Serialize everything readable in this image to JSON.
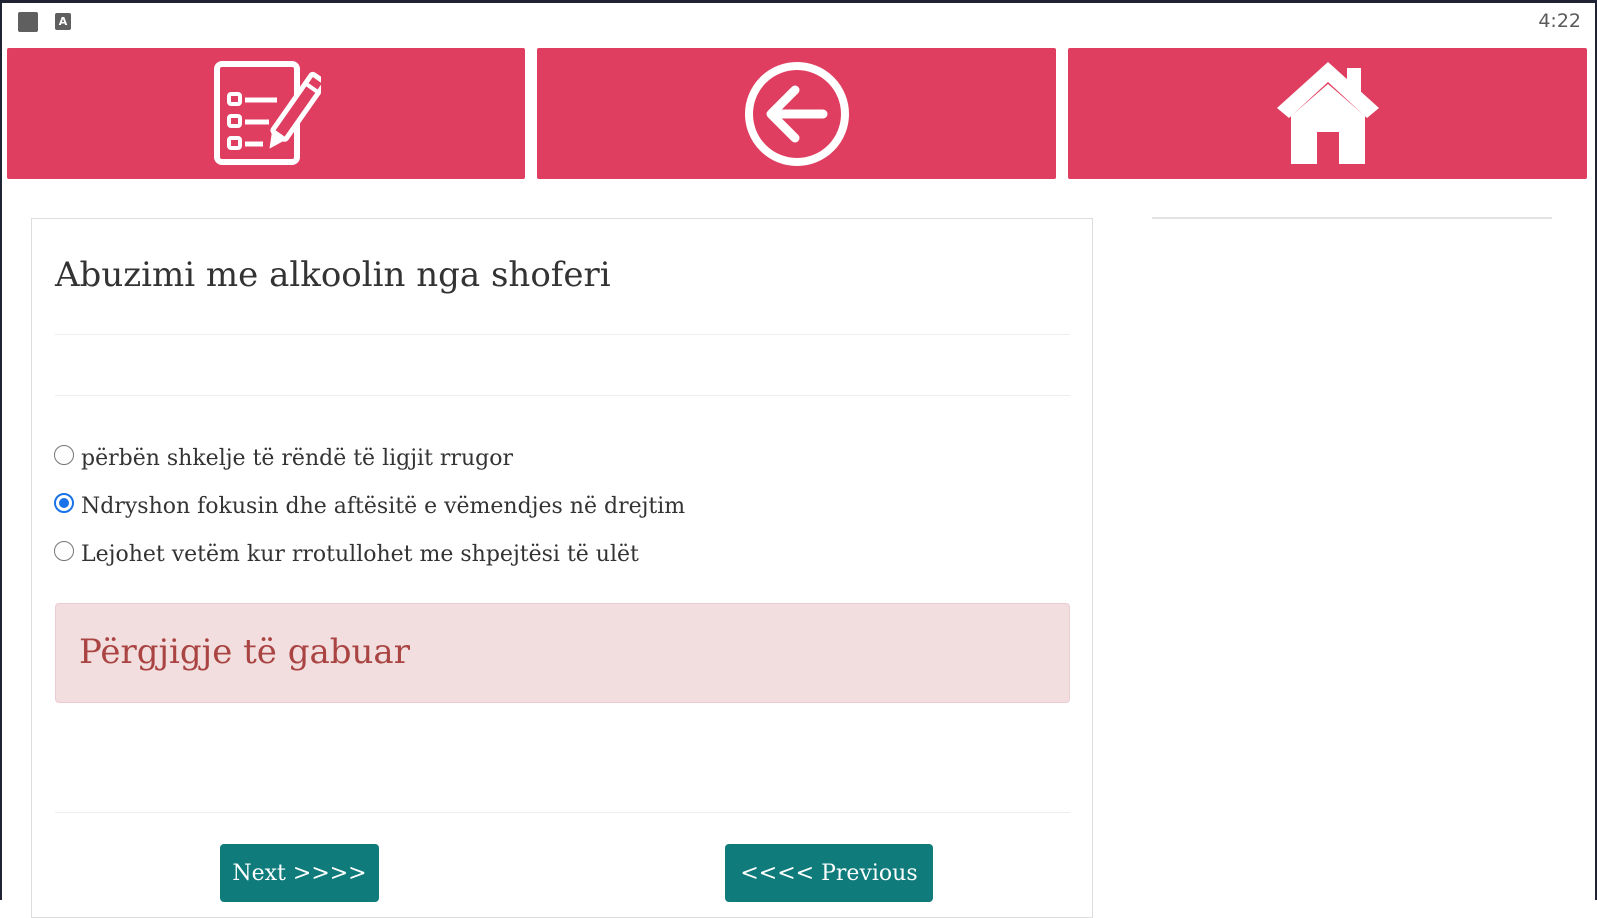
{
  "status_bar": {
    "time": "4:22",
    "a_icon_letter": "A"
  },
  "nav": {
    "quiz_icon": "checklist-pencil-icon",
    "back_icon": "arrow-left-circle-icon",
    "home_icon": "home-icon"
  },
  "colors": {
    "nav_background": "#e03e60",
    "button_background": "#0f7b7b",
    "alert_background": "#f2dede",
    "alert_text": "#a94442",
    "radio_checked": "#1a73e8"
  },
  "question": {
    "title": "Abuzimi me alkoolin nga shoferi",
    "options": [
      {
        "label": "përbën shkelje të rëndë të ligjit rrugor",
        "checked": false
      },
      {
        "label": "Ndryshon fokusin dhe aftësitë e vëmendjes në drejtim",
        "checked": true
      },
      {
        "label": "Lejohet vetëm kur rrotullohet me shpejtësi të ulët",
        "checked": false
      }
    ]
  },
  "feedback": {
    "message": "Përgjigje të gabuar"
  },
  "buttons": {
    "next_label": "Next >>>>",
    "previous_label": "<<<< Previous"
  }
}
